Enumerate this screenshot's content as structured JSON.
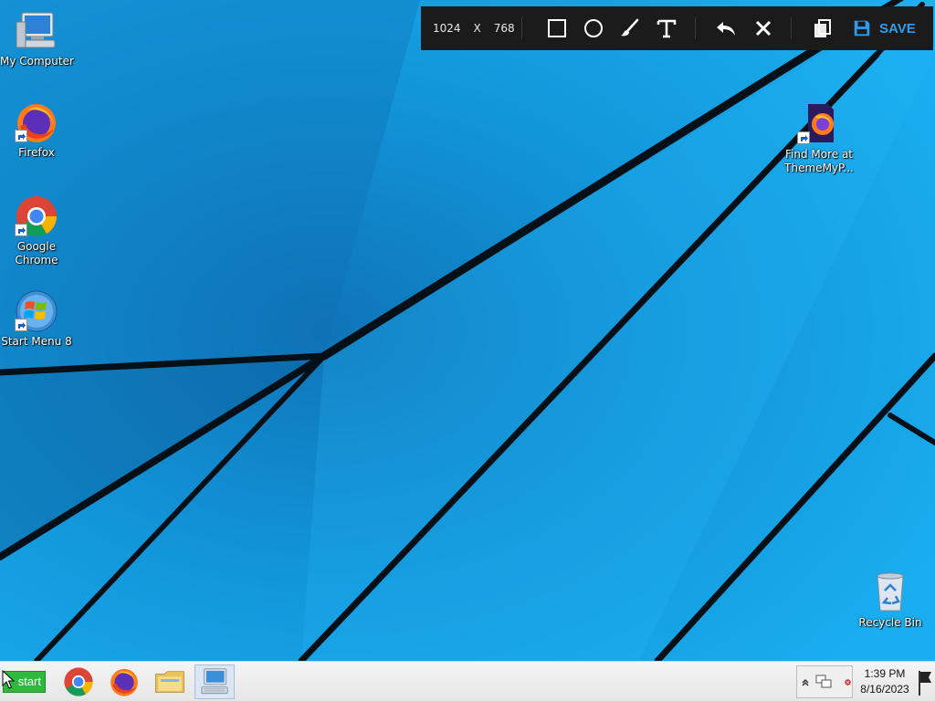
{
  "desktop": {
    "background_color": "#14a2e4",
    "icons": [
      {
        "label": "My Computer",
        "icon": "computer-icon"
      },
      {
        "label": "Firefox",
        "icon": "firefox-icon"
      },
      {
        "label": "Google Chrome",
        "icon": "chrome-icon"
      },
      {
        "label": "Start Menu 8",
        "icon": "windows-orb-icon"
      },
      {
        "label": "Find More at ThemeMyP...",
        "icon": "firefox-document-icon"
      },
      {
        "label": "Recycle Bin",
        "icon": "recycle-bin-icon"
      }
    ]
  },
  "capture_toolbar": {
    "width": "1024",
    "x_label": "X",
    "height": "768",
    "tools": [
      "rectangle-icon",
      "circle-icon",
      "brush-icon",
      "text-icon",
      "undo-icon",
      "close-icon",
      "copy-icon"
    ],
    "save_label": "SAVE",
    "accent_color": "#2f9cf0"
  },
  "taskbar": {
    "start_label": "start",
    "pinned": [
      {
        "name": "Google Chrome",
        "icon": "chrome-icon"
      },
      {
        "name": "Firefox",
        "icon": "firefox-icon"
      },
      {
        "name": "File Explorer",
        "icon": "folder-icon"
      },
      {
        "name": "Remote Desktop",
        "icon": "computer-keyboard-icon"
      }
    ],
    "tray_icons": [
      "chevron-up-icon",
      "network-icon",
      "alert-icon"
    ],
    "time": "1:39 PM",
    "date": "8/16/2023"
  }
}
